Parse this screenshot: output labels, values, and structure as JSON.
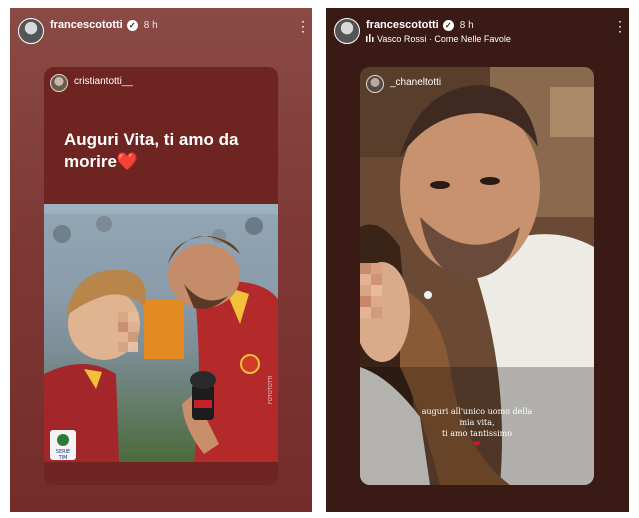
{
  "stories": [
    {
      "username": "francescototti",
      "time": "8 h",
      "reshared_username": "cristiantotti__",
      "caption": "Auguri Vita, ti amo da morire",
      "caption_emoji": "❤️",
      "shirt_text": "FOTOTOTTI",
      "badge_line1": "SERIE",
      "badge_line2": "TIM"
    },
    {
      "username": "francescototti",
      "time": "8 h",
      "music_artist": "Vasco Rossi",
      "music_separator": "·",
      "music_title": "Come Nelle Favole",
      "reshared_username": "_chaneltotti",
      "caption_line1": "auguri all'unico uomo della",
      "caption_line2": "mia vita,",
      "caption_line3": "ti amo tantissimo",
      "caption_emoji": "❤"
    }
  ],
  "icons": {
    "verified": "verified-badge-icon",
    "more": "more-options-icon",
    "music": "music-bars-icon",
    "heart": "heart-icon"
  }
}
